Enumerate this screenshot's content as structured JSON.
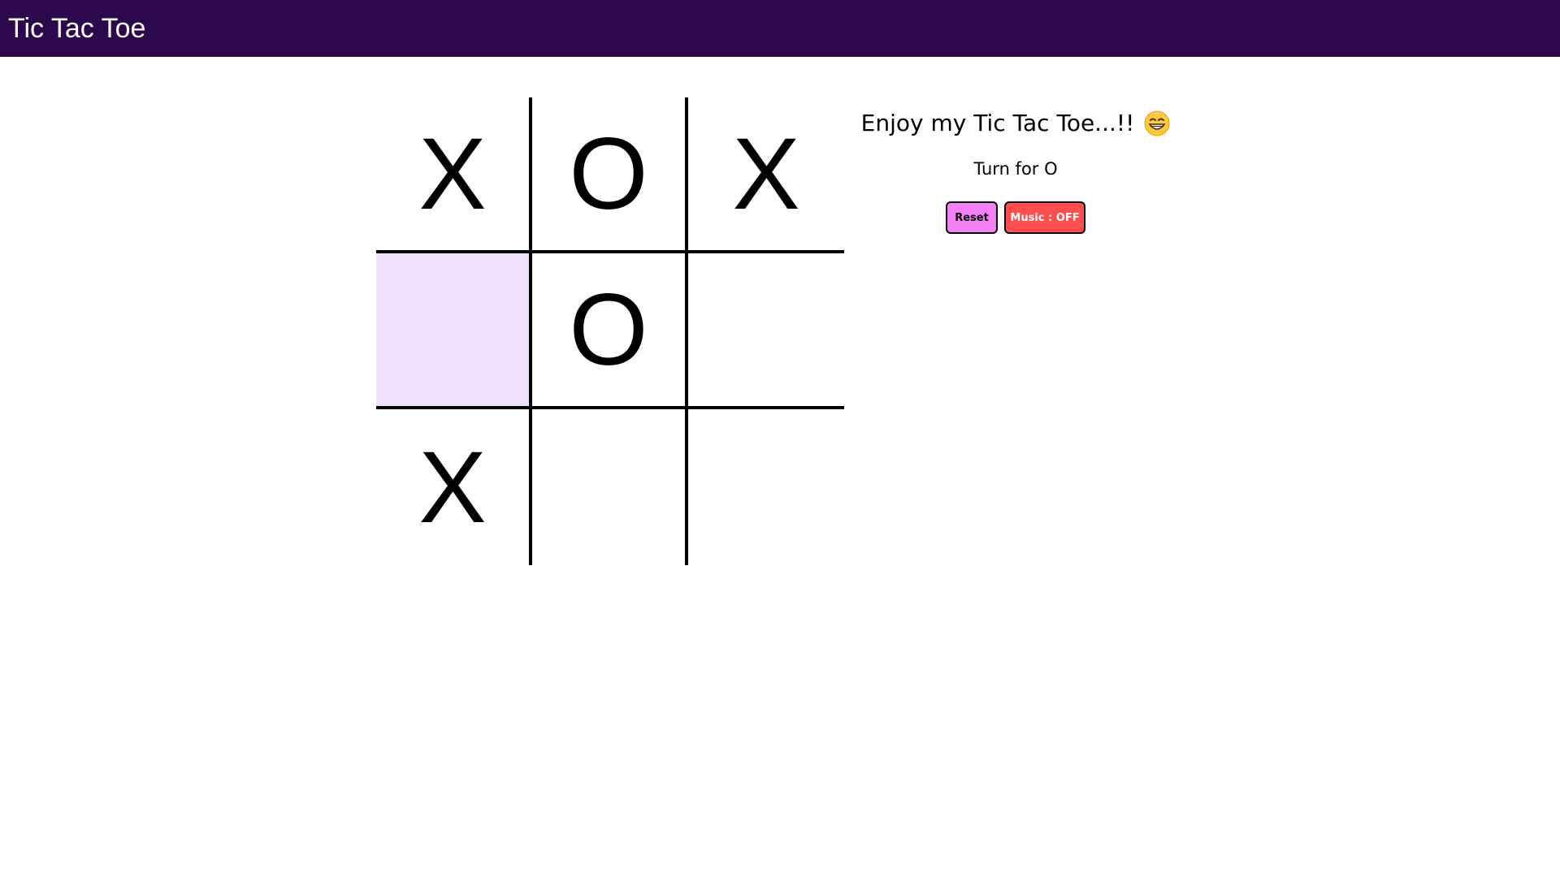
{
  "navbar": {
    "brand": "Tic Tac Toe",
    "color": "#2c084c"
  },
  "board": {
    "cells": [
      "X",
      "O",
      "X",
      "",
      "O",
      "",
      "X",
      "",
      ""
    ],
    "highlight_color": "#efe0fd"
  },
  "info": {
    "title": "Enjoy my Tic Tac Toe...!!",
    "emoji": "grinning-face-icon",
    "turn_text": "Turn for O"
  },
  "buttons": {
    "reset_label": "Reset",
    "reset_color": "#f580f5",
    "music_label": "Music : OFF",
    "music_color": "#ff4c4c"
  }
}
